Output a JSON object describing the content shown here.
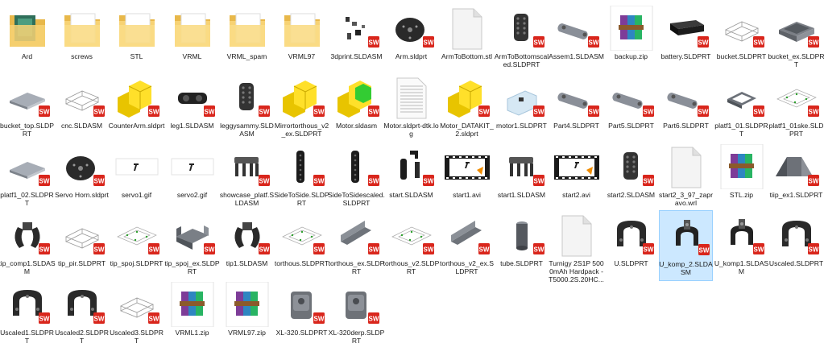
{
  "window": {
    "view": "Large icons"
  },
  "files": [
    {
      "name": "Ard",
      "icon": "folder-ard-icon",
      "kind": "folder"
    },
    {
      "name": "screws",
      "icon": "folder-screws-icon",
      "kind": "folder"
    },
    {
      "name": "STL",
      "icon": "folder-icon",
      "kind": "folder"
    },
    {
      "name": "VRML",
      "icon": "folder-icon",
      "kind": "folder"
    },
    {
      "name": "VRML_spam",
      "icon": "folder-icon",
      "kind": "folder"
    },
    {
      "name": "VRML97",
      "icon": "folder-icon",
      "kind": "folder"
    },
    {
      "name": "3dprint.SLDASM",
      "icon": "solidworks-assembly-icon",
      "kind": "parts"
    },
    {
      "name": "Arm.sldprt",
      "icon": "solidworks-part-icon",
      "kind": "disc"
    },
    {
      "name": "ArmToBottom.stl",
      "icon": "blank-document-icon",
      "kind": "doc"
    },
    {
      "name": "ArmToBottomscaled.SLDPRT",
      "icon": "solidworks-part-icon",
      "kind": "bracket"
    },
    {
      "name": "Assem1.SLDASM",
      "icon": "solidworks-assembly-icon",
      "kind": "link"
    },
    {
      "name": "backup.zip",
      "icon": "winrar-archive-icon",
      "kind": "zip"
    },
    {
      "name": "battery.SLDPRT",
      "icon": "solidworks-part-icon",
      "kind": "battery"
    },
    {
      "name": "bucket.SLDPRT",
      "icon": "solidworks-part-icon",
      "kind": "wire"
    },
    {
      "name": "bucket_ex.SLDPRT",
      "icon": "solidworks-part-icon",
      "kind": "tray"
    },
    {
      "name": "bucket_top.SLDPRT",
      "icon": "solidworks-part-icon",
      "kind": "plate"
    },
    {
      "name": "cnc.SLDASM",
      "icon": "solidworks-assembly-icon",
      "kind": "wire"
    },
    {
      "name": "CounterArm.sldprt",
      "icon": "solidworks-part-icon",
      "kind": "yellow"
    },
    {
      "name": "leg1.SLDASM",
      "icon": "solidworks-assembly-icon",
      "kind": "servo"
    },
    {
      "name": "leggysammy.SLDASM",
      "icon": "solidworks-assembly-icon",
      "kind": "bracket"
    },
    {
      "name": "Mirrortorthous_v2_ex.SLDPRT",
      "icon": "solidworks-part-icon",
      "kind": "yellow"
    },
    {
      "name": "Motor.sldasm",
      "icon": "solidworks-assembly-icon",
      "kind": "yellowgreen"
    },
    {
      "name": "Motor.sldprt-dtk.log",
      "icon": "text-document-icon",
      "kind": "log"
    },
    {
      "name": "Motor_DATAKIT_2.sldprt",
      "icon": "solidworks-part-icon",
      "kind": "yellow"
    },
    {
      "name": "motor1.SLDPRT",
      "icon": "solidworks-part-icon",
      "kind": "glass"
    },
    {
      "name": "Part4.SLDPRT",
      "icon": "solidworks-part-icon",
      "kind": "link"
    },
    {
      "name": "Part5.SLDPRT",
      "icon": "solidworks-part-icon",
      "kind": "link"
    },
    {
      "name": "Part6.SLDPRT",
      "icon": "solidworks-part-icon",
      "kind": "link"
    },
    {
      "name": "platf1_01.SLDPRT",
      "icon": "solidworks-part-icon",
      "kind": "frame"
    },
    {
      "name": "platf1_01ske.SLDPRT",
      "icon": "solidworks-part-icon",
      "kind": "sketch"
    },
    {
      "name": "platf1_02.SLDPRT",
      "icon": "solidworks-part-icon",
      "kind": "plate"
    },
    {
      "name": "Servo Horn.sldprt",
      "icon": "solidworks-part-icon",
      "kind": "disc"
    },
    {
      "name": "servo1.gif",
      "icon": "gif-image-icon",
      "kind": "gif"
    },
    {
      "name": "servo2.gif",
      "icon": "gif-image-icon",
      "kind": "gif"
    },
    {
      "name": "showcase_platf.SLDASM",
      "icon": "solidworks-assembly-icon",
      "kind": "legs"
    },
    {
      "name": "SideToSide.SLDPRT",
      "icon": "solidworks-part-icon",
      "kind": "bar"
    },
    {
      "name": "SideToSidescaled.SLDPRT",
      "icon": "solidworks-part-icon",
      "kind": "bar"
    },
    {
      "name": "start.SLDASM",
      "icon": "solidworks-assembly-icon",
      "kind": "twobars"
    },
    {
      "name": "start1.avi",
      "icon": "video-file-icon",
      "kind": "video"
    },
    {
      "name": "start1.SLDASM",
      "icon": "solidworks-assembly-icon",
      "kind": "legs"
    },
    {
      "name": "start2.avi",
      "icon": "video-file-icon",
      "kind": "video"
    },
    {
      "name": "start2.SLDASM",
      "icon": "solidworks-assembly-icon",
      "kind": "bracket"
    },
    {
      "name": "start2_3_97_zapravo.wrl",
      "icon": "blank-document-icon",
      "kind": "doc"
    },
    {
      "name": "STL.zip",
      "icon": "winrar-archive-icon",
      "kind": "zip"
    },
    {
      "name": "tiip_ex1.SLDPRT",
      "icon": "solidworks-part-icon",
      "kind": "pyramid"
    },
    {
      "name": "tip_comp1.SLDASM",
      "icon": "solidworks-assembly-icon",
      "kind": "claw"
    },
    {
      "name": "tip_pir.SLDPRT",
      "icon": "solidworks-part-icon",
      "kind": "wire"
    },
    {
      "name": "tip_spoj.SLDPRT",
      "icon": "solidworks-part-icon",
      "kind": "sketch"
    },
    {
      "name": "tip_spoj_ex.SLDPRT",
      "icon": "solidworks-part-icon",
      "kind": "ubracket"
    },
    {
      "name": "tip1.SLDASM",
      "icon": "solidworks-assembly-icon",
      "kind": "claw"
    },
    {
      "name": "torthous.SLDPRT",
      "icon": "solidworks-part-icon",
      "kind": "sketch"
    },
    {
      "name": "torthous_ex.SLDPRT",
      "icon": "solidworks-part-icon",
      "kind": "channel"
    },
    {
      "name": "torthous_v2.SLDPRT",
      "icon": "solidworks-part-icon",
      "kind": "sketch"
    },
    {
      "name": "torthous_v2_ex.SLDPRT",
      "icon": "solidworks-part-icon",
      "kind": "channel"
    },
    {
      "name": "tube.SLDPRT",
      "icon": "solidworks-part-icon",
      "kind": "tube"
    },
    {
      "name": "Turnigy 2S1P 5000mAh Hardpack - T5000.2S.20HC...",
      "icon": "blank-document-icon",
      "kind": "doc"
    },
    {
      "name": "U.SLDPRT",
      "icon": "solidworks-part-icon",
      "kind": "ushape"
    },
    {
      "name": "U_komp_2.SLDASM",
      "icon": "solidworks-assembly-icon",
      "kind": "ukomp",
      "selected": true
    },
    {
      "name": "U_komp1.SLDASM",
      "icon": "solidworks-assembly-icon",
      "kind": "ukomp"
    },
    {
      "name": "Uscaled.SLDPRT",
      "icon": "solidworks-part-icon",
      "kind": "ushape"
    },
    {
      "name": "Uscaled1.SLDPRT",
      "icon": "solidworks-part-icon",
      "kind": "ushape"
    },
    {
      "name": "Uscaled2.SLDPRT",
      "icon": "solidworks-part-icon",
      "kind": "ushape"
    },
    {
      "name": "Uscaled3.SLDPRT",
      "icon": "solidworks-part-icon",
      "kind": "wire"
    },
    {
      "name": "VRML1.zip",
      "icon": "winrar-archive-icon",
      "kind": "zip"
    },
    {
      "name": "VRML97.zip",
      "icon": "winrar-archive-icon",
      "kind": "zip"
    },
    {
      "name": "XL-320.SLDPRT",
      "icon": "solidworks-part-icon",
      "kind": "servobox"
    },
    {
      "name": "XL-320derp.SLDPRT",
      "icon": "solidworks-part-icon",
      "kind": "servobox"
    }
  ]
}
